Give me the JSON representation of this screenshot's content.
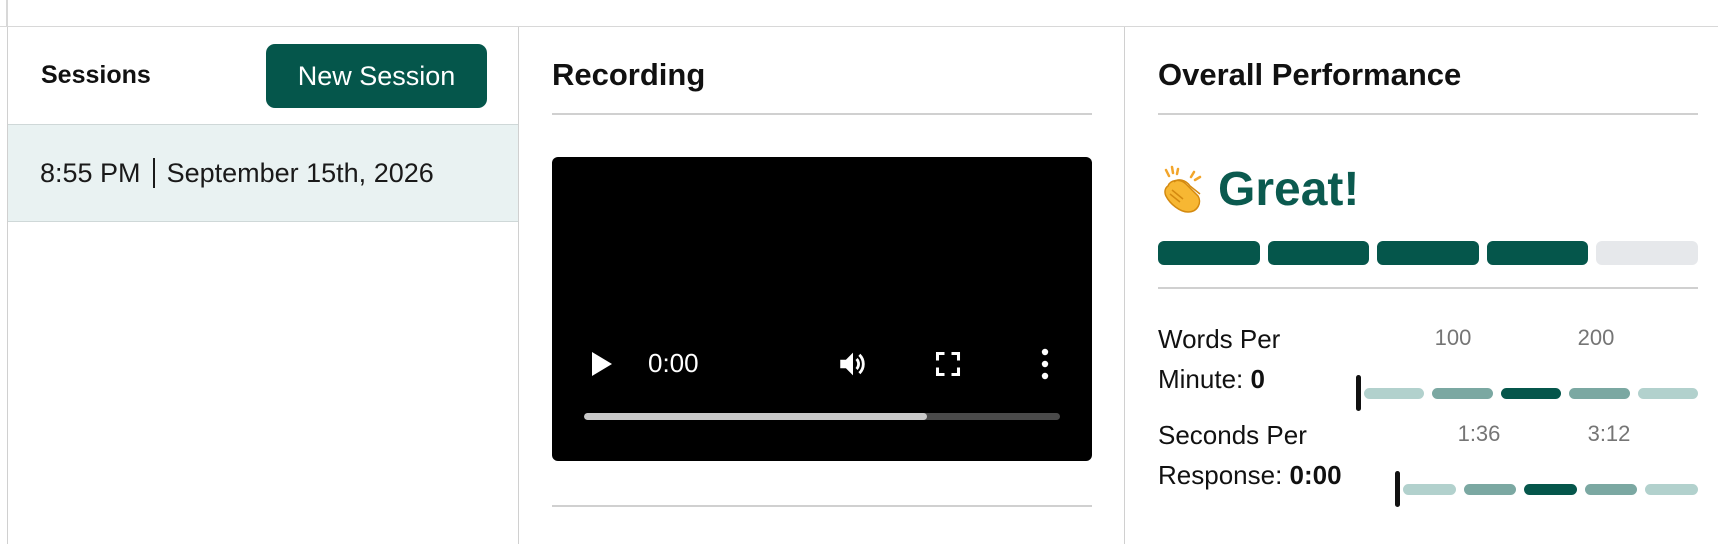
{
  "sessions": {
    "title": "Sessions",
    "new_session_label": "New Session",
    "items": [
      {
        "time": "8:55 PM",
        "date": "September 15th, 2026",
        "selected": true
      }
    ]
  },
  "recording": {
    "title": "Recording",
    "video": {
      "time": "0:00",
      "buffered_fraction": 0.72
    }
  },
  "performance": {
    "title": "Overall Performance",
    "rating_label": "Great!",
    "rating_icon": "clapping-hands-icon",
    "rating_level": 4,
    "rating_max": 5,
    "colors": {
      "accent": "#05564b",
      "empty": "#e6e8eb",
      "light": "#b2d1cd",
      "mid": "#7ba8a2",
      "dark": "#05564b"
    },
    "metrics": [
      {
        "label_line1": "Words Per",
        "label_line2": "Minute:",
        "value": "0",
        "tick1": "100",
        "tick2": "200"
      },
      {
        "label_line1": "Seconds Per",
        "label_line2": "Response:",
        "value": "0:00",
        "tick1": "1:36",
        "tick2": "3:12"
      }
    ]
  }
}
